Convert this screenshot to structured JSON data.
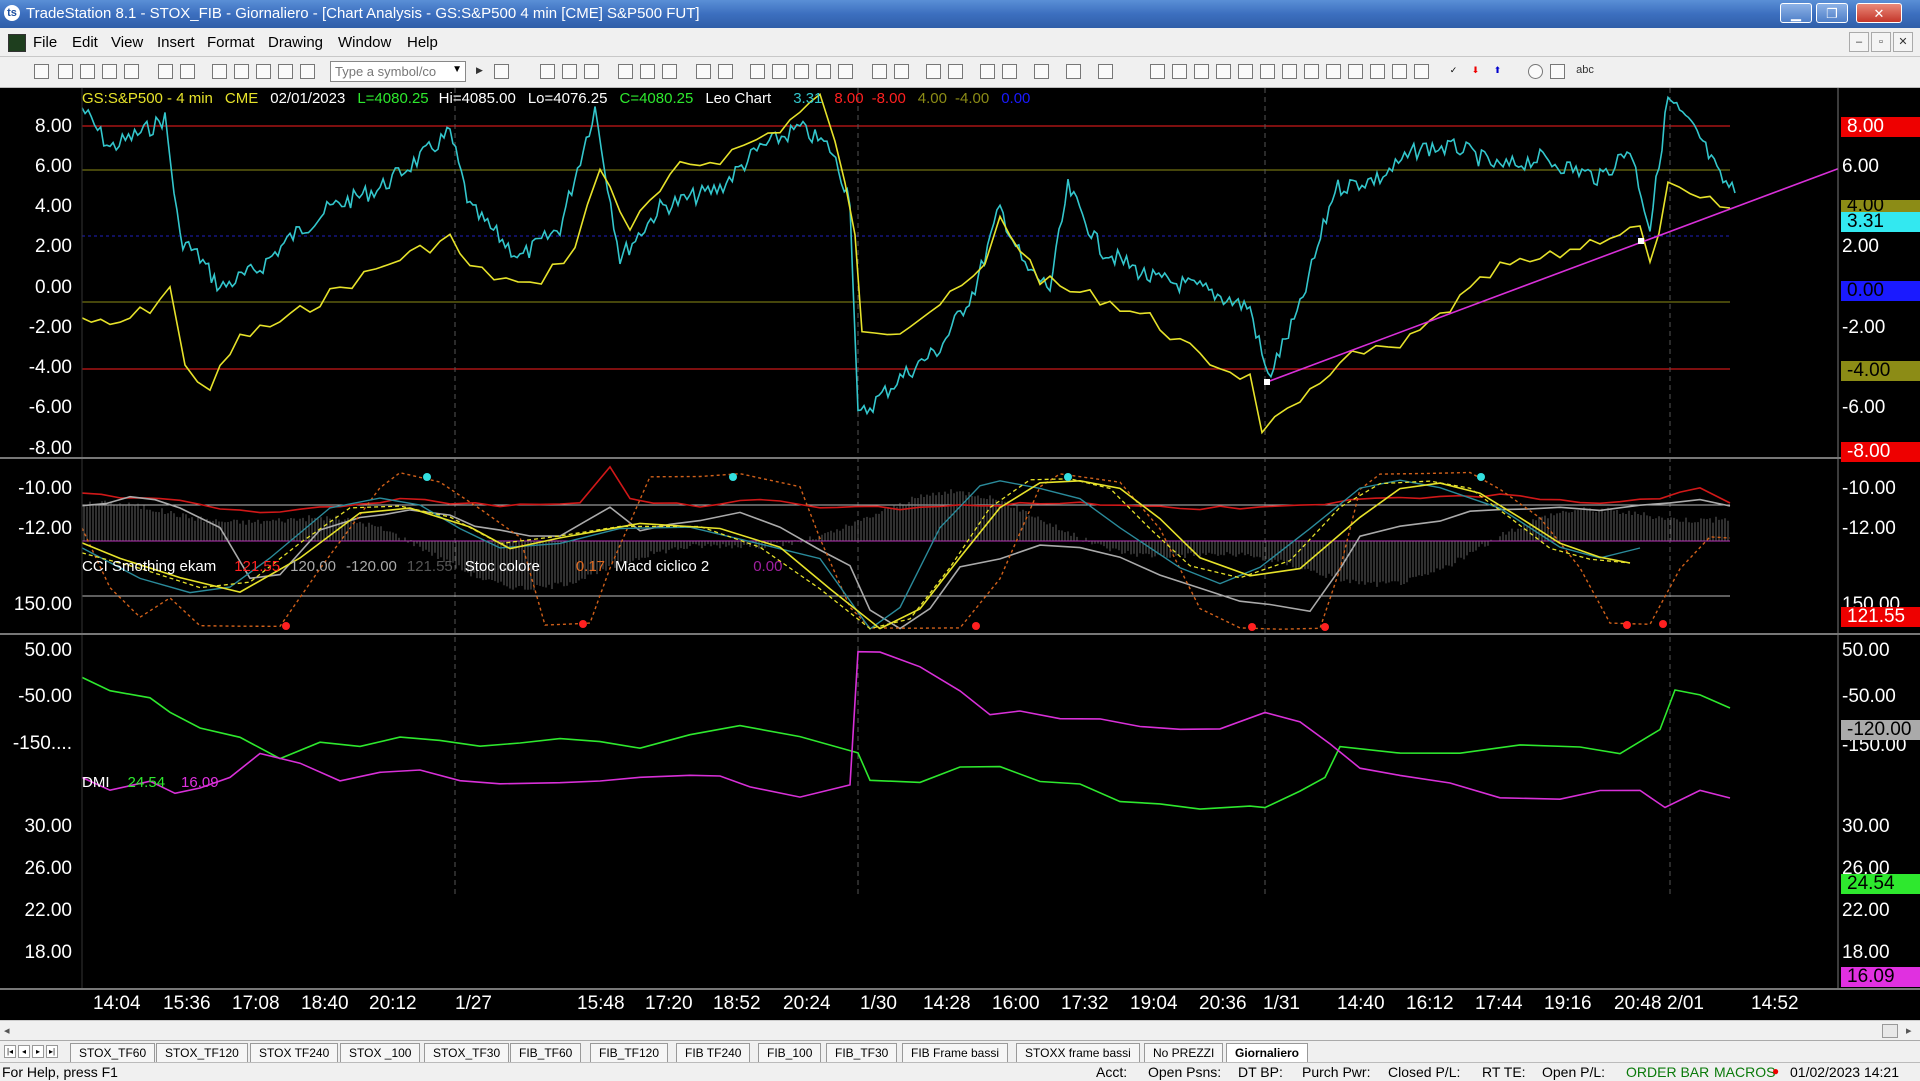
{
  "window": {
    "title": "TradeStation 8.1 - STOX_FIB - Giornaliero - [Chart Analysis - GS:S&P500  4 min  [CME] S&P500 FUT]"
  },
  "menu": [
    "File",
    "Edit",
    "View",
    "Insert",
    "Format",
    "Drawing",
    "Window",
    "Help"
  ],
  "toolbar": {
    "symbol_placeholder": "Type a symbol/co"
  },
  "price_panel": {
    "header": {
      "symbol": "GS:S&P500 - 4 min",
      "exchange": "CME",
      "date": "02/01/2023",
      "last": "L=4080.25",
      "high": "Hi=4085.00",
      "low": "Lo=4076.25",
      "close": "C=4080.25",
      "study": "Leo Chart",
      "v1": "3.31",
      "v2": "8.00",
      "v3": "-8.00",
      "v4": "4.00",
      "v5": "-4.00",
      "v6": "0.00"
    },
    "yticks": [
      "8.00",
      "6.00",
      "4.00",
      "2.00",
      "0.00",
      "-2.00",
      "-4.00",
      "-6.00",
      "-8.00",
      "-10.00",
      "-12.00"
    ],
    "right_ticks": [
      "6.00",
      "2.00",
      "-2.00",
      "-6.00",
      "-10.00",
      "-12.00"
    ],
    "tags": {
      "upper": "8.00",
      "mid_up": "4.00",
      "cyan": "3.31",
      "zero": "0.00",
      "mid_dn": "-4.00",
      "lower": "-8.00"
    }
  },
  "cci_panel": {
    "header": {
      "name": "CCI Smothing ekam",
      "v1": "121.55",
      "v2": "120.00",
      "v3": "-120.00",
      "v4": "121.55",
      "stoc": "Stoc colore",
      "stoc_v": "0.17",
      "macd": "Macd ciclico 2",
      "macd_v": "0.00"
    },
    "yticks": [
      "150.00",
      "50.00",
      "-50.00",
      "-150...."
    ],
    "right_ticks": [
      "150.00",
      "50.00",
      "-50.00",
      "-150.00"
    ],
    "tags": {
      "upper": "121.55",
      "lower": "-120.00"
    }
  },
  "dmi_panel": {
    "header": {
      "name": "DMI",
      "plus": "24.54",
      "minus": "16.09"
    },
    "yticks": [
      "30.00",
      "26.00",
      "22.00",
      "18.00"
    ],
    "right_ticks": [
      "30.00",
      "26.00",
      "22.00",
      "18.00"
    ],
    "tags": {
      "plus": "24.54",
      "minus": "16.09"
    }
  },
  "xaxis": [
    "14:04",
    "15:36",
    "17:08",
    "18:40",
    "20:12",
    "1/27",
    "15:48",
    "17:20",
    "18:52",
    "20:24",
    "1/30",
    "14:28",
    "16:00",
    "17:32",
    "19:04",
    "20:36",
    "1/31",
    "14:40",
    "16:12",
    "17:44",
    "19:16",
    "20:48",
    "2/01",
    "14:52"
  ],
  "sheet_tabs": [
    "STOX_TF60",
    "STOX_TF120",
    "STOX TF240",
    "STOX _100",
    "STOX_TF30",
    "FIB_TF60",
    "FIB_TF120",
    "FIB TF240",
    "FIB_100",
    "FIB_TF30",
    "FIB Frame bassi",
    "STOXX frame bassi",
    "No PREZZI",
    "Giornaliero"
  ],
  "status": {
    "help": "For Help, press F1",
    "acct": "Acct:",
    "open_psns": "Open Psns:",
    "dt_bp": "DT BP:",
    "purch_pwr": "Purch Pwr:",
    "closed_pl": "Closed P/L:",
    "rt_te": "RT TE:",
    "open_pl": "Open P/L:",
    "order_bar": "ORDER BAR",
    "macros": "MACROS",
    "datetime": "01/02/2023 14:21"
  },
  "colors": {
    "cyan": "#33c6cc",
    "yellow": "#e6e22a",
    "red": "#ff1a1a",
    "olive": "#8c8c16",
    "magenta": "#e030e0",
    "green": "#2ee82e",
    "orange": "#e06a20",
    "blue": "#1a1aff"
  }
}
